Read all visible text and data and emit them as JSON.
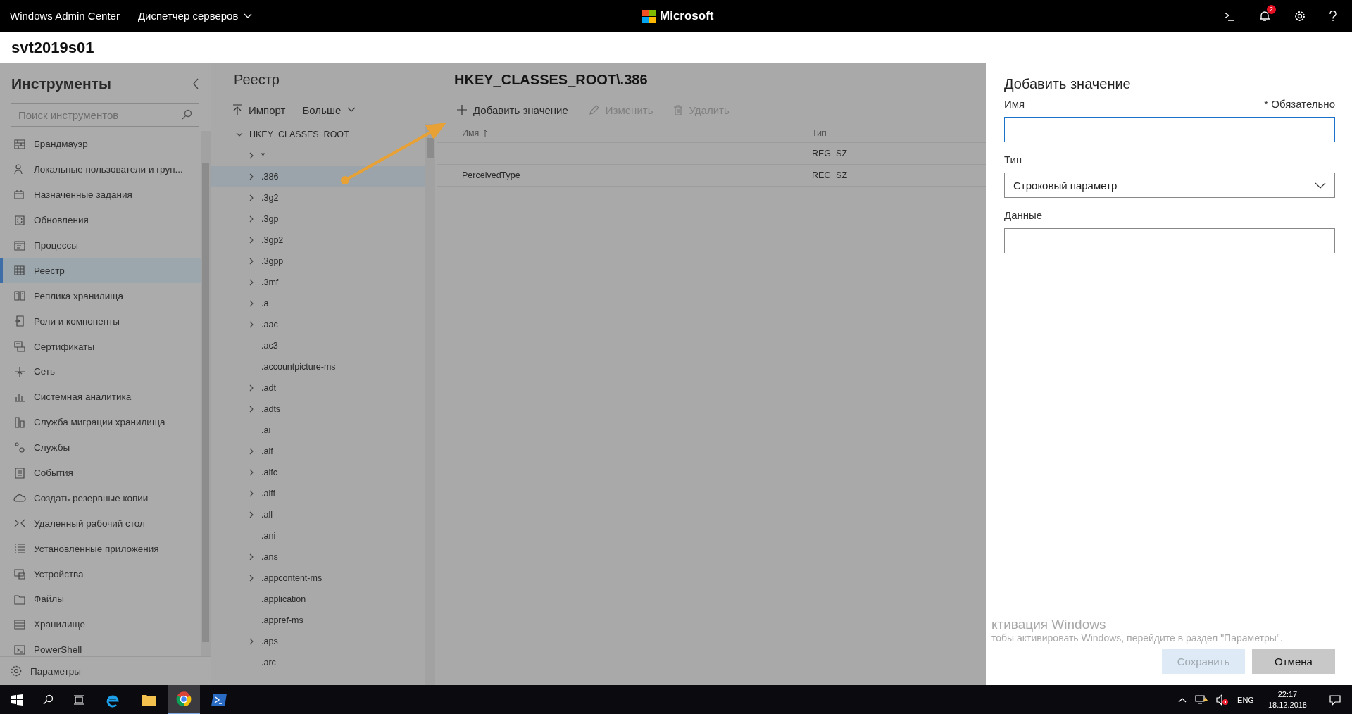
{
  "app_bar": {
    "title": "Windows Admin Center",
    "connection_menu": "Диспетчер серверов",
    "brand": "Microsoft",
    "notification_count": "2"
  },
  "server_name": "svt2019s01",
  "tools": {
    "title": "Инструменты",
    "search_placeholder": "Поиск инструментов",
    "items": [
      {
        "label": "Брандмауэр",
        "selected": false
      },
      {
        "label": "Локальные пользователи и груп...",
        "selected": false
      },
      {
        "label": "Назначенные задания",
        "selected": false
      },
      {
        "label": "Обновления",
        "selected": false
      },
      {
        "label": "Процессы",
        "selected": false
      },
      {
        "label": "Реестр",
        "selected": true
      },
      {
        "label": "Реплика хранилища",
        "selected": false
      },
      {
        "label": "Роли и компоненты",
        "selected": false
      },
      {
        "label": "Сертификаты",
        "selected": false
      },
      {
        "label": "Сеть",
        "selected": false
      },
      {
        "label": "Системная аналитика",
        "selected": false
      },
      {
        "label": "Служба миграции хранилища",
        "selected": false
      },
      {
        "label": "Службы",
        "selected": false
      },
      {
        "label": "События",
        "selected": false
      },
      {
        "label": "Создать резервные копии",
        "selected": false
      },
      {
        "label": "Удаленный рабочий стол",
        "selected": false
      },
      {
        "label": "Установленные приложения",
        "selected": false
      },
      {
        "label": "Устройства",
        "selected": false
      },
      {
        "label": "Файлы",
        "selected": false
      },
      {
        "label": "Хранилище",
        "selected": false
      },
      {
        "label": "PowerShell",
        "selected": false
      }
    ],
    "footer": "Параметры"
  },
  "registry": {
    "title": "Реестр",
    "import": "Импорт",
    "more": "Больше",
    "tree": {
      "label": "HKEY_CLASSES_ROOT",
      "expanded": true,
      "children": [
        {
          "label": "*",
          "has_children": true,
          "selected": false
        },
        {
          "label": ".386",
          "has_children": true,
          "selected": true
        },
        {
          "label": ".3g2",
          "has_children": true,
          "selected": false
        },
        {
          "label": ".3gp",
          "has_children": true,
          "selected": false
        },
        {
          "label": ".3gp2",
          "has_children": true,
          "selected": false
        },
        {
          "label": ".3gpp",
          "has_children": true,
          "selected": false
        },
        {
          "label": ".3mf",
          "has_children": true,
          "selected": false
        },
        {
          "label": ".a",
          "has_children": true,
          "selected": false
        },
        {
          "label": ".aac",
          "has_children": true,
          "selected": false
        },
        {
          "label": ".ac3",
          "has_children": false,
          "selected": false
        },
        {
          "label": ".accountpicture-ms",
          "has_children": false,
          "selected": false
        },
        {
          "label": ".adt",
          "has_children": true,
          "selected": false
        },
        {
          "label": ".adts",
          "has_children": true,
          "selected": false
        },
        {
          "label": ".ai",
          "has_children": false,
          "selected": false
        },
        {
          "label": ".aif",
          "has_children": true,
          "selected": false
        },
        {
          "label": ".aifc",
          "has_children": true,
          "selected": false
        },
        {
          "label": ".aiff",
          "has_children": true,
          "selected": false
        },
        {
          "label": ".all",
          "has_children": true,
          "selected": false
        },
        {
          "label": ".ani",
          "has_children": false,
          "selected": false
        },
        {
          "label": ".ans",
          "has_children": true,
          "selected": false
        },
        {
          "label": ".appcontent-ms",
          "has_children": true,
          "selected": false
        },
        {
          "label": ".application",
          "has_children": false,
          "selected": false
        },
        {
          "label": ".appref-ms",
          "has_children": false,
          "selected": false
        },
        {
          "label": ".aps",
          "has_children": true,
          "selected": false
        },
        {
          "label": ".arc",
          "has_children": false,
          "selected": false
        }
      ]
    }
  },
  "values": {
    "path": "HKEY_CLASSES_ROOT\\.386",
    "toolbar": [
      {
        "kind": "add",
        "label": "Добавить значение",
        "disabled": false
      },
      {
        "kind": "edit",
        "label": "Изменить",
        "disabled": true
      },
      {
        "kind": "delete",
        "label": "Удалить",
        "disabled": true
      }
    ],
    "columns": [
      "Имя",
      "Тип"
    ],
    "rows": [
      {
        "type": "REG_SZ"
      },
      {
        "name": "PerceivedType",
        "type": "REG_SZ"
      }
    ]
  },
  "panel": {
    "title": "Добавить значение",
    "fields": [
      {
        "kind": "text",
        "label": "Имя",
        "required_note": "* Обязательно",
        "focused": true
      },
      {
        "kind": "select",
        "label": "Тип",
        "value": "Строковый параметр"
      },
      {
        "kind": "text",
        "label": "Данные",
        "focused": false
      }
    ],
    "buttons": [
      {
        "label": "Сохранить",
        "primary": true,
        "disabled": true
      },
      {
        "label": "Отмена",
        "primary": false,
        "disabled": false
      }
    ]
  },
  "activation_notice": {
    "title": "ктивация Windows",
    "text": "тобы активировать Windows, перейдите в раздел \"Параметры\"."
  },
  "taskbar": {
    "language": "ENG",
    "time": "22:17",
    "date": "18.12.2018"
  }
}
